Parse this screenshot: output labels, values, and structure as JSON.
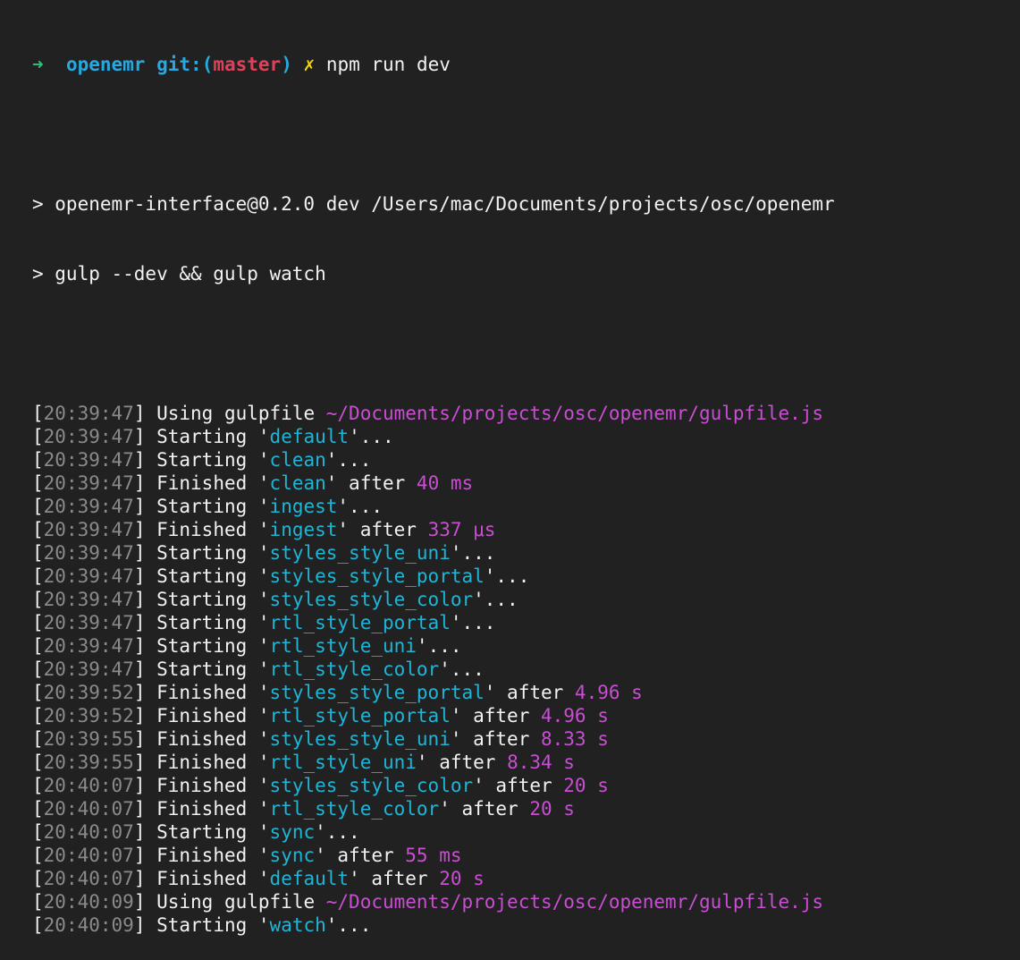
{
  "prompt": {
    "arrow": "➜",
    "directory": "openemr",
    "git_label": "git:(",
    "branch": "master",
    "git_close": ")",
    "dirty_mark": "✗",
    "command": "npm run dev"
  },
  "npm_header": [
    "> openemr-interface@0.2.0 dev /Users/mac/Documents/projects/osc/openemr",
    "> gulp --dev && gulp watch"
  ],
  "log": [
    {
      "time": "20:39:47",
      "kind": "using",
      "text": "Using gulpfile ",
      "path": "~/Documents/projects/osc/openemr/gulpfile.js"
    },
    {
      "time": "20:39:47",
      "kind": "starting",
      "task": "default"
    },
    {
      "time": "20:39:47",
      "kind": "starting",
      "task": "clean"
    },
    {
      "time": "20:39:47",
      "kind": "finished",
      "task": "clean",
      "duration": "40 ms"
    },
    {
      "time": "20:39:47",
      "kind": "starting",
      "task": "ingest"
    },
    {
      "time": "20:39:47",
      "kind": "finished",
      "task": "ingest",
      "duration": "337 μs"
    },
    {
      "time": "20:39:47",
      "kind": "starting",
      "task": "styles_style_uni"
    },
    {
      "time": "20:39:47",
      "kind": "starting",
      "task": "styles_style_portal"
    },
    {
      "time": "20:39:47",
      "kind": "starting",
      "task": "styles_style_color"
    },
    {
      "time": "20:39:47",
      "kind": "starting",
      "task": "rtl_style_portal"
    },
    {
      "time": "20:39:47",
      "kind": "starting",
      "task": "rtl_style_uni"
    },
    {
      "time": "20:39:47",
      "kind": "starting",
      "task": "rtl_style_color"
    },
    {
      "time": "20:39:52",
      "kind": "finished",
      "task": "styles_style_portal",
      "duration": "4.96 s"
    },
    {
      "time": "20:39:52",
      "kind": "finished",
      "task": "rtl_style_portal",
      "duration": "4.96 s"
    },
    {
      "time": "20:39:55",
      "kind": "finished",
      "task": "styles_style_uni",
      "duration": "8.33 s"
    },
    {
      "time": "20:39:55",
      "kind": "finished",
      "task": "rtl_style_uni",
      "duration": "8.34 s"
    },
    {
      "time": "20:40:07",
      "kind": "finished",
      "task": "styles_style_color",
      "duration": "20 s"
    },
    {
      "time": "20:40:07",
      "kind": "finished",
      "task": "rtl_style_color",
      "duration": "20 s"
    },
    {
      "time": "20:40:07",
      "kind": "starting",
      "task": "sync"
    },
    {
      "time": "20:40:07",
      "kind": "finished",
      "task": "sync",
      "duration": "55 ms"
    },
    {
      "time": "20:40:07",
      "kind": "finished",
      "task": "default",
      "duration": "20 s"
    },
    {
      "time": "20:40:09",
      "kind": "using",
      "text": "Using gulpfile ",
      "path": "~/Documents/projects/osc/openemr/gulpfile.js"
    },
    {
      "time": "20:40:09",
      "kind": "starting",
      "task": "watch"
    }
  ],
  "words": {
    "starting": "Starting '",
    "finished": "Finished '",
    "after": "' after ",
    "ellipsis": "'..."
  },
  "colors": {
    "background": "#212121",
    "foreground": "#f2f2f2",
    "timestamp": "#8a8a8a",
    "task": "#1fb5d6",
    "number": "#c84fd1",
    "prompt_arrow": "#2ec27e",
    "prompt_dir": "#28a8e0",
    "branch": "#e0415a",
    "dirty": "#f5d90a"
  }
}
